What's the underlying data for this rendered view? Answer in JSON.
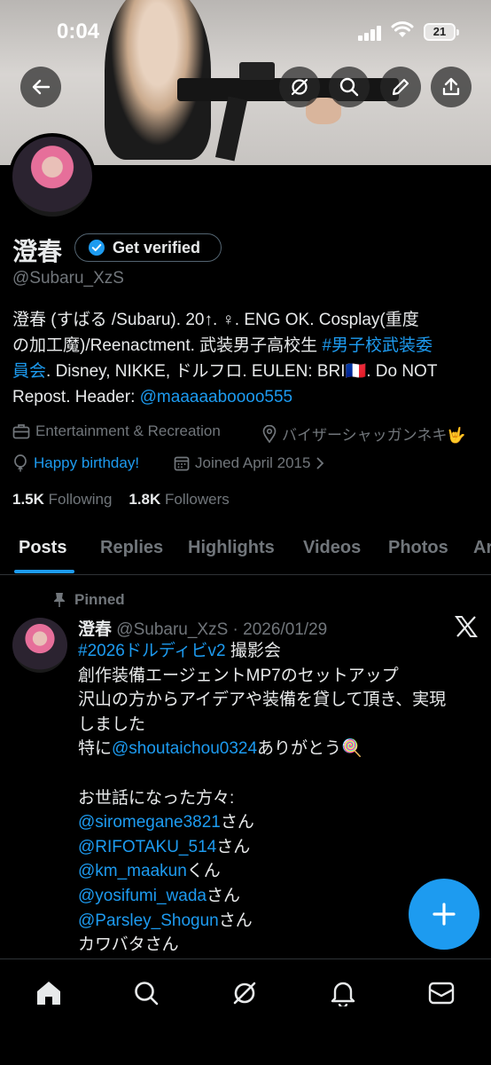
{
  "status_bar": {
    "time": "0:04",
    "battery": "21"
  },
  "profile": {
    "display_name": "澄春",
    "get_verified_label": "Get verified",
    "handle": "@Subaru_XzS",
    "bio": {
      "line1": "澄春 (すばる /Subaru). 20↑. ♀. ENG OK. Cosplay(重度",
      "line2a": "の加工魔)/Reenactment. 武装男子高校生 ",
      "line2_tag": "#男子校武装委",
      "line3_tag": "員会",
      "line3b": ". Disney, NIKKE, ドルフロ. EULEN: BRI",
      "line3_flag": "🇫🇷",
      "line3c": ". Do NOT",
      "line4a": "Repost. Header: ",
      "line4_link": "@maaaaaboooo555"
    },
    "category": "Entertainment & Recreation",
    "location": "バイザーシャッガンネキ🤟",
    "birthday": "Happy birthday!",
    "joined": "Joined April 2015",
    "following_count": "1.5K",
    "following_label": "Following",
    "followers_count": "1.8K",
    "followers_label": "Followers"
  },
  "tabs": [
    "Posts",
    "Replies",
    "Highlights",
    "Videos",
    "Photos",
    "Ar"
  ],
  "tweet": {
    "pinned_label": "Pinned",
    "author": "澄春",
    "handle_date": "@Subaru_XzS · 2026/01/29",
    "line1_tag": "#2026ドルディビv2",
    "line1_rest": " 撮影会",
    "line2": "創作装備エージェントMP7のセットアップ",
    "line3": "沢山の方からアイデアや装備を貸して頂き、実現",
    "line4": "しました",
    "line5_pre": "特に",
    "line5_link": "@shoutaichou0324",
    "line5_post": "ありがとう🍭",
    "line7": "お世話になった方々:",
    "mentions": [
      {
        "link": "@siromegane3821",
        "suffix": "さん"
      },
      {
        "link": "@RIFOTAKU_514",
        "suffix": "さん"
      },
      {
        "link": "@km_maakun",
        "suffix": "くん"
      },
      {
        "link": "@yosifumi_wada",
        "suffix": "さん"
      },
      {
        "link": "@Parsley_Shogun",
        "suffix": "さん"
      }
    ],
    "last_line": "カワバタさん"
  },
  "colors": {
    "accent": "#1d9bf0",
    "muted": "#71767b",
    "text": "#e7e9ea",
    "background": "#000000"
  },
  "icons": [
    "back-arrow-icon",
    "grok-icon",
    "search-icon",
    "edit-icon",
    "share-icon",
    "verified-badge-icon",
    "briefcase-icon",
    "location-pin-icon",
    "balloon-icon",
    "calendar-icon",
    "pin-icon",
    "x-logo-icon",
    "plus-icon",
    "home-icon",
    "explore-icon",
    "grok-nav-icon",
    "notifications-icon",
    "messages-icon"
  ]
}
